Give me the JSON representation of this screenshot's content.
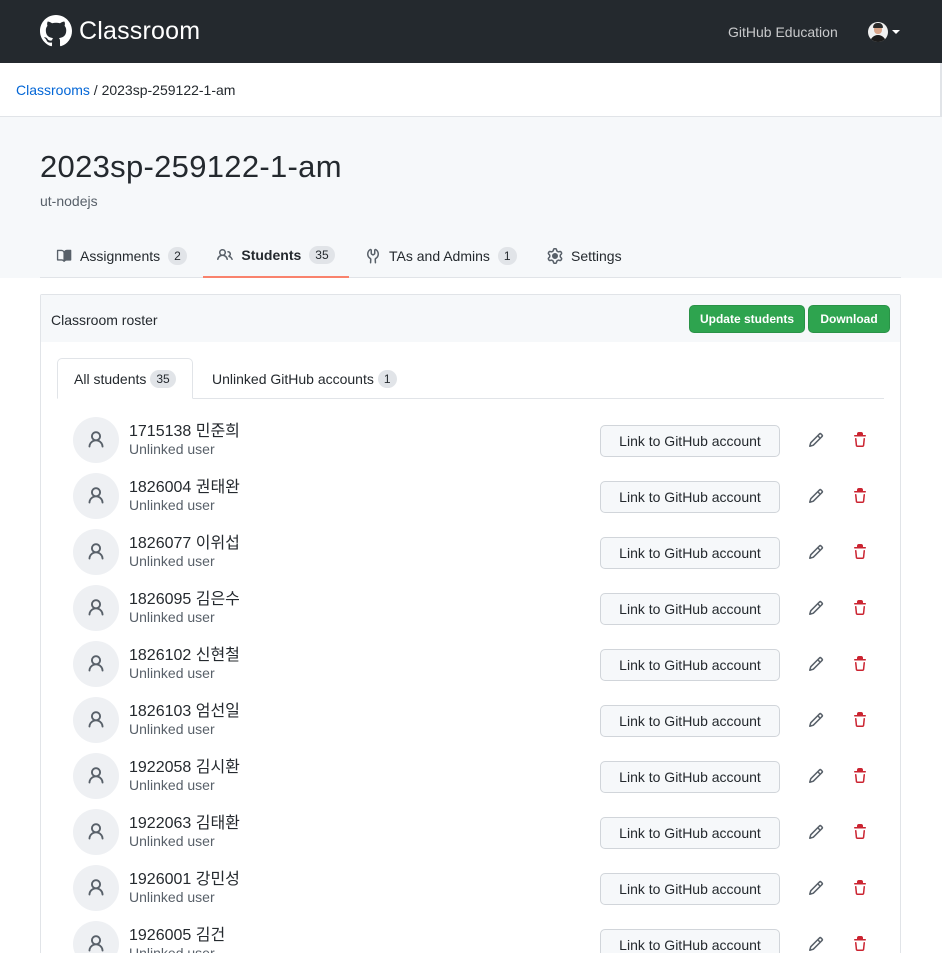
{
  "header": {
    "brand": "Classroom",
    "education_link": "GitHub Education"
  },
  "breadcrumb": {
    "root": "Classrooms",
    "separator": " / ",
    "current": "2023sp-259122-1-am"
  },
  "classroom": {
    "title": "2023sp-259122-1-am",
    "org": "ut-nodejs"
  },
  "tabs": [
    {
      "label": "Assignments",
      "count": "2",
      "icon": "book-icon"
    },
    {
      "label": "Students",
      "count": "35",
      "icon": "people-icon",
      "active": true
    },
    {
      "label": "TAs and Admins",
      "count": "1",
      "icon": "tools-icon"
    },
    {
      "label": "Settings",
      "icon": "gear-icon"
    }
  ],
  "roster": {
    "title": "Classroom roster",
    "update_button": "Update students",
    "download_button": "Download",
    "subtabs": [
      {
        "label": "All students",
        "count": "35",
        "active": true
      },
      {
        "label": "Unlinked GitHub accounts",
        "count": "1"
      }
    ],
    "link_label": "Link to GitHub account",
    "students": [
      {
        "name": "1715138 민준희",
        "status": "Unlinked user"
      },
      {
        "name": "1826004 권태완",
        "status": "Unlinked user"
      },
      {
        "name": "1826077 이위섭",
        "status": "Unlinked user"
      },
      {
        "name": "1826095 김은수",
        "status": "Unlinked user"
      },
      {
        "name": "1826102 신현철",
        "status": "Unlinked user"
      },
      {
        "name": "1826103 엄선일",
        "status": "Unlinked user"
      },
      {
        "name": "1922058 김시환",
        "status": "Unlinked user"
      },
      {
        "name": "1922063 김태환",
        "status": "Unlinked user"
      },
      {
        "name": "1926001 강민성",
        "status": "Unlinked user"
      },
      {
        "name": "1926005 김건",
        "status": "Unlinked user"
      }
    ]
  },
  "colors": {
    "header_bg": "#24292e",
    "link": "#0366d6",
    "primary_button": "#2ea44f",
    "active_tab_underline": "#f9826c",
    "danger": "#cb2431"
  }
}
